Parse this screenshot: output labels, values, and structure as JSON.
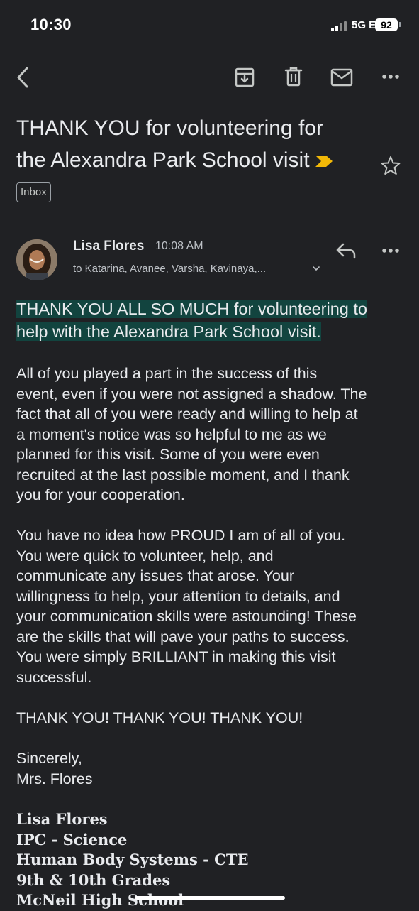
{
  "status_bar": {
    "time": "10:30",
    "network": "5G E",
    "battery": "92"
  },
  "toolbar": {
    "icons": [
      "back-arrow-icon",
      "archive-icon",
      "trash-icon",
      "mail-icon",
      "more-vert-icon"
    ]
  },
  "subject": "THANK YOU for volunteering for the Alexandra Park School visit",
  "label": "Inbox",
  "message": {
    "sender": "Lisa Flores",
    "time": "10:08 AM",
    "recipients": "to Katarina, Avanee, Varsha, Kavinaya,..."
  },
  "body": {
    "highlight": "THANK YOU ALL SO MUCH for volunteering to help with the Alexandra Park School visit.",
    "para1_lines": [
      "All of you played a part in the success of this",
      "event, even if you were not assigned a shadow. The",
      "fact that all of you were ready and willing to help at",
      "a moment's notice was so helpful to me as we",
      "planned for this visit. Some of you were even",
      "recruited at the last possible moment, and I thank",
      "you for your cooperation."
    ],
    "para2_lines": [
      "You have no idea how PROUD I am of all of you.",
      "You were quick to volunteer, help, and",
      "communicate any issues that arose. Your",
      "willingness to help, your attention to details, and",
      "your communication skills were astounding! These",
      "are the skills that will pave your paths to success.",
      "You were simply BRILLIANT in making this visit",
      "successful."
    ],
    "thanks": "THANK YOU! THANK YOU! THANK YOU!",
    "closing": "Sincerely,",
    "closing_name": "Mrs. Flores"
  },
  "signature": {
    "name": "Lisa Flores",
    "line1": "IPC - Science",
    "line2": "Human Body Systems - CTE",
    "line3": "9th & 10th Grades",
    "line4": "McNeil High School"
  },
  "colors": {
    "background": "#202124",
    "highlight": "#12443f",
    "important_marker": "#f2b807"
  }
}
